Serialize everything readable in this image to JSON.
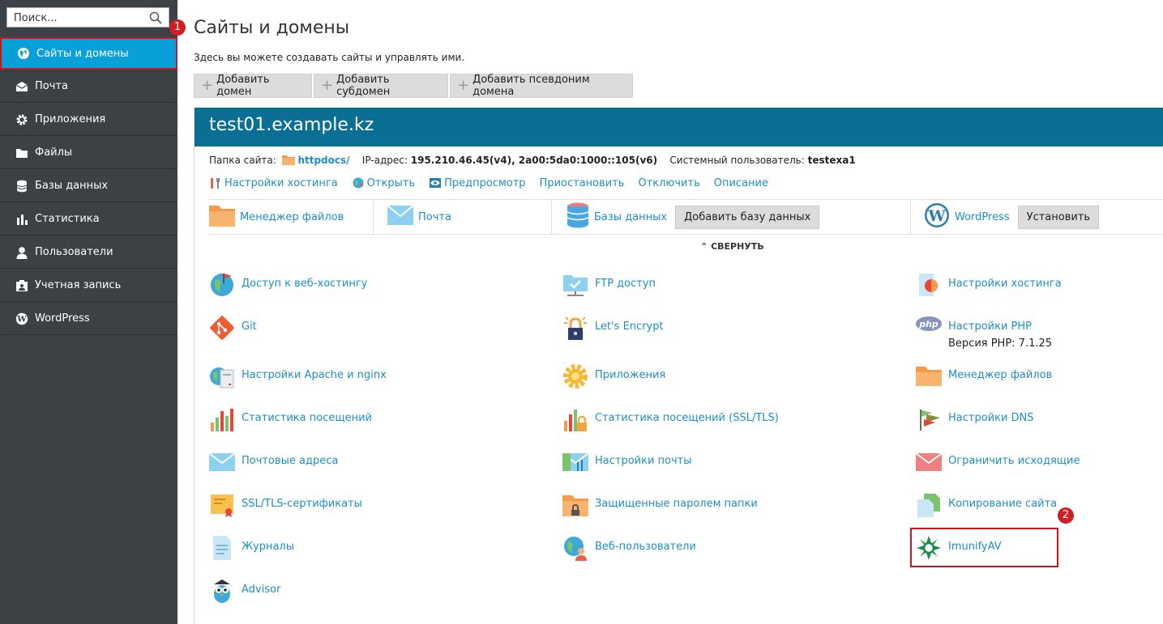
{
  "search": {
    "placeholder": "Поиск..."
  },
  "sidebar": {
    "items": [
      {
        "label": "Сайты и домены",
        "icon": "globe-icon",
        "active": true
      },
      {
        "label": "Почта",
        "icon": "envelope-icon"
      },
      {
        "label": "Приложения",
        "icon": "gear-icon"
      },
      {
        "label": "Файлы",
        "icon": "folder-icon"
      },
      {
        "label": "Базы данных",
        "icon": "database-icon"
      },
      {
        "label": "Статистика",
        "icon": "bar-chart-icon"
      },
      {
        "label": "Пользователи",
        "icon": "user-icon"
      },
      {
        "label": "Учетная запись",
        "icon": "id-card-icon"
      },
      {
        "label": "WordPress",
        "icon": "wordpress-icon"
      }
    ]
  },
  "badges": {
    "first": "1",
    "second": "2"
  },
  "page": {
    "title": "Сайты и домены",
    "description": "Здесь вы можете создавать сайты и управлять ими."
  },
  "toolbar": {
    "add_domain": "Добавить домен",
    "add_subdomain": "Добавить субдомен",
    "add_alias": "Добавить псевдоним домена"
  },
  "domain": {
    "name": "test01.example.kz",
    "folder_label": "Папка сайта:",
    "folder_value": "httpdocs/",
    "ip_label": "IP-адрес:",
    "ip_value": "195.210.46.45(v4), 2a00:5da0:1000::105(v6)",
    "user_label": "Системный пользователь:",
    "user_value": "testexa1",
    "actions": {
      "hosting_settings": "Настройки хостинга",
      "open": "Открыть",
      "preview": "Предпросмотр",
      "suspend": "Приостановить",
      "disable": "Отключить",
      "description": "Описание"
    },
    "quick": {
      "file_manager": "Менеджер файлов",
      "mail": "Почта",
      "databases": "Базы данных",
      "add_database": "Добавить базу данных",
      "wordpress": "WordPress",
      "install": "Установить"
    },
    "collapse": "СВЕРНУТЬ"
  },
  "tools": {
    "col1": [
      "Доступ к веб-хостингу",
      "Git",
      "Настройки Apache и nginx",
      "Статистика посещений",
      "Почтовые адреса",
      "SSL/TLS-сертификаты",
      "Журналы",
      "Advisor"
    ],
    "col2": [
      "FTP доступ",
      "Let's Encrypt",
      "Приложения",
      "Статистика посещений (SSL/TLS)",
      "Настройки почты",
      "Защищенные паролем папки",
      "Веб-пользователи"
    ],
    "col3": [
      "Настройки хостинга",
      "Настройки PHP",
      "Менеджер файлов",
      "Настройки DNS",
      "Ограничить исходящие",
      "Копирование сайта",
      "ImunifyAV"
    ],
    "php_version": "Версия PHP: 7.1.25"
  }
}
